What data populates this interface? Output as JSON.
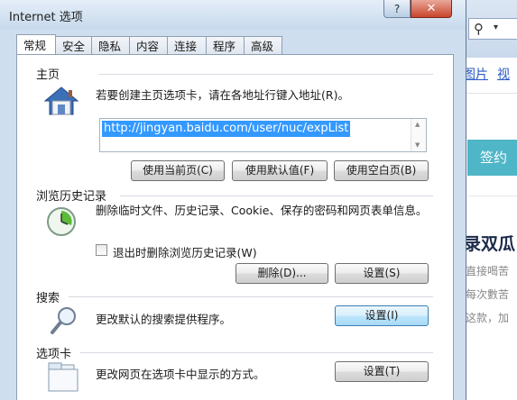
{
  "background_page": {
    "search_icon": "⚲",
    "search_caret": "▾",
    "links": [
      "图片",
      "视"
    ],
    "button_label": "签约",
    "headline": "录双瓜",
    "text_lines": [
      "直接喝苦",
      "每次數苦",
      "这款，加"
    ],
    "accent_color": "#4fb6c8"
  },
  "dialog": {
    "title": "Internet 选项",
    "help_label": "?",
    "close_label": "✕",
    "tabs": [
      "常规",
      "安全",
      "隐私",
      "内容",
      "连接",
      "程序",
      "高级"
    ],
    "active_tab": "常规",
    "home": {
      "label": "主页",
      "description": "若要创建主页选项卡，请在各地址行键入地址(R)。",
      "url": "http://jingyan.baidu.com/user/nuc/expList",
      "buttons": [
        "使用当前页(C)",
        "使用默认值(F)",
        "使用空白页(B)"
      ]
    },
    "history": {
      "label": "浏览历史记录",
      "description": "删除临时文件、历史记录、Cookie、保存的密码和网页表单信息。",
      "checkbox_label": "退出时删除浏览历史记录(W)",
      "checkbox_checked": false,
      "delete_button": "删除(D)...",
      "settings_button": "设置(S)"
    },
    "search": {
      "label": "搜索",
      "description": "更改默认的搜索提供程序。",
      "settings_button": "设置(I)"
    },
    "tabs_section": {
      "label": "选项卡",
      "description": "更改网页在选项卡中显示的方式。",
      "settings_button": "设置(T)"
    }
  }
}
